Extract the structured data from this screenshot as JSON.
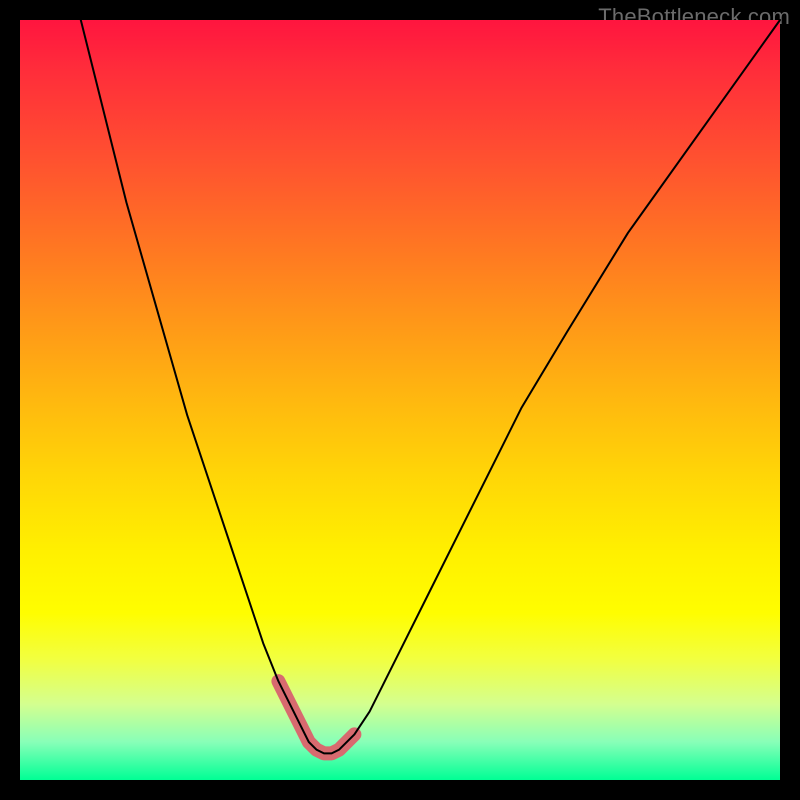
{
  "watermark": {
    "text": "TheBottleneck.com"
  },
  "colors": {
    "background": "#000000",
    "curve": "#000000",
    "valley_highlight": "#d86a6f",
    "gradient_top": "#ff153f",
    "gradient_bottom": "#00ff95"
  },
  "chart_data": {
    "type": "line",
    "title": "",
    "xlabel": "",
    "ylabel": "",
    "xlim": [
      0,
      100
    ],
    "ylim": [
      0,
      100
    ],
    "grid": false,
    "legend": false,
    "series": [
      {
        "name": "bottleneck-curve",
        "x": [
          8,
          10,
          12,
          14,
          16,
          18,
          20,
          22,
          24,
          26,
          28,
          30,
          32,
          34,
          36,
          37,
          38,
          39,
          40,
          41,
          42,
          44,
          46,
          48,
          50,
          54,
          58,
          62,
          66,
          72,
          80,
          90,
          100
        ],
        "values": [
          100,
          92,
          84,
          76,
          69,
          62,
          55,
          48,
          42,
          36,
          30,
          24,
          18,
          13,
          9,
          7,
          5,
          4,
          3.5,
          3.5,
          4,
          6,
          9,
          13,
          17,
          25,
          33,
          41,
          49,
          59,
          72,
          86,
          100
        ],
        "highlight_valley_x_range": [
          33,
          44
        ]
      }
    ],
    "annotations": []
  }
}
